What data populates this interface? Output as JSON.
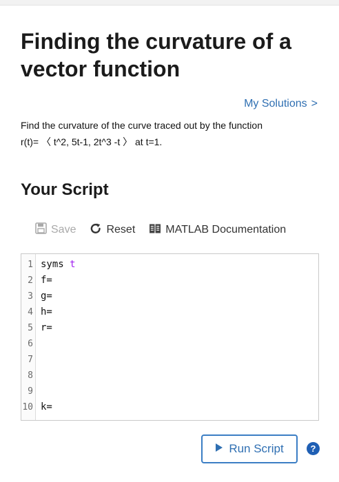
{
  "problem": {
    "title": "Finding the curvature of a vector function",
    "my_solutions_label": "My Solutions",
    "my_solutions_chevron": ">",
    "statement_line1": "Find the curvature of the curve traced out by the function",
    "statement_line2": "r(t)= 〈 t^2,  5t-1,  2t^3 -t 〉  at t=1."
  },
  "script": {
    "section_title": "Your Script",
    "toolbar": {
      "save_label": "Save",
      "reset_label": "Reset",
      "doc_label": "MATLAB Documentation",
      "save_enabled": false
    },
    "lines": [
      {
        "num": "1",
        "code": "syms ",
        "arg": "t"
      },
      {
        "num": "2",
        "code": "f=",
        "arg": ""
      },
      {
        "num": "3",
        "code": "g=",
        "arg": ""
      },
      {
        "num": "4",
        "code": "h=",
        "arg": ""
      },
      {
        "num": "5",
        "code": "r=",
        "arg": ""
      },
      {
        "num": "6",
        "code": "",
        "arg": ""
      },
      {
        "num": "7",
        "code": "",
        "arg": ""
      },
      {
        "num": "8",
        "code": "",
        "arg": ""
      },
      {
        "num": "9",
        "code": "",
        "arg": ""
      },
      {
        "num": "10",
        "code": "k=",
        "arg": ""
      }
    ],
    "run_label": "Run Script",
    "help_label": "?"
  },
  "colors": {
    "link": "#2f6fb2",
    "keyword_arg": "#a020f0",
    "help_badge": "#1f5fb4"
  }
}
